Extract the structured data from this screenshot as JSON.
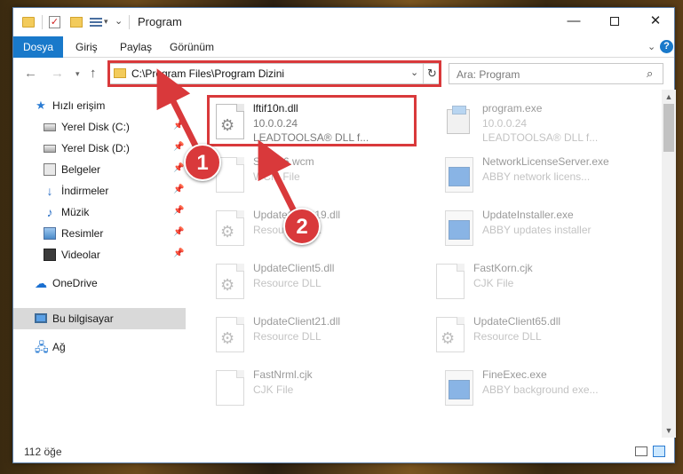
{
  "window": {
    "title": "Program",
    "minimize_glyph": "—",
    "close_glyph": "✕"
  },
  "ribbon": {
    "tabs": [
      {
        "label": "Dosya",
        "active": true
      },
      {
        "label": "Giriş"
      },
      {
        "label": "Paylaş"
      },
      {
        "label": "Görünüm"
      }
    ],
    "help_glyph": "?"
  },
  "nav": {
    "back_glyph": "←",
    "forward_glyph": "→",
    "up_glyph": "↑",
    "address": "C:\\Program Files\\Program Dizini",
    "search_placeholder": "Ara: Program"
  },
  "sidebar": {
    "items": [
      {
        "label": "Hızlı erişim",
        "icon": "star-icon",
        "pinned": false
      },
      {
        "label": "Yerel Disk (C:)",
        "icon": "drive-icon",
        "pinned": true
      },
      {
        "label": "Yerel Disk (D:)",
        "icon": "drive-icon",
        "pinned": true
      },
      {
        "label": "Belgeler",
        "icon": "documents-icon",
        "pinned": true
      },
      {
        "label": "İndirmeler",
        "icon": "download-icon",
        "pinned": true
      },
      {
        "label": "Müzik",
        "icon": "music-icon",
        "pinned": true
      },
      {
        "label": "Resimler",
        "icon": "pictures-icon",
        "pinned": true
      },
      {
        "label": "Videolar",
        "icon": "video-icon",
        "pinned": true
      },
      {
        "label": "OneDrive",
        "icon": "cloud-icon",
        "pinned": false
      },
      {
        "label": "Bu bilgisayar",
        "icon": "computer-icon",
        "pinned": false,
        "selected": true
      },
      {
        "label": "Ağ",
        "icon": "network-icon",
        "pinned": false
      }
    ]
  },
  "files": {
    "left": [
      {
        "name": "lftif10n.dll",
        "sub1": "10.0.0.24",
        "sub2": "LEADTOOLSA® DLL f...",
        "icon": "dll-gear-icon",
        "highlighted": true
      },
      {
        "name": "SWP16.wcm",
        "sub1": "WCM File",
        "sub2": "",
        "icon": "document-icon"
      },
      {
        "name": "UpdateClient19.dll",
        "sub1": "Resource DLL",
        "sub2": "",
        "icon": "dll-gear-icon"
      },
      {
        "name": "UpdateClient5.dll",
        "sub1": "Resource DLL",
        "sub2": "",
        "icon": "dll-gear-icon"
      },
      {
        "name": "UpdateClient21.dll",
        "sub1": "Resource DLL",
        "sub2": "",
        "icon": "dll-gear-icon"
      },
      {
        "name": "FastNrml.cjk",
        "sub1": "CJK File",
        "sub2": "",
        "icon": "document-icon"
      }
    ],
    "right": [
      {
        "name": "program.exe",
        "sub1": "10.0.0.24",
        "sub2": "LEADTOOLSA® DLL f...",
        "icon": "program-exe-icon"
      },
      {
        "name": "NetworkLicenseServer.exe",
        "sub1": "ABBY network licens...",
        "sub2": "",
        "icon": "exe-window-icon"
      },
      {
        "name": "UpdateInstaller.exe",
        "sub1": "ABBY updates installer",
        "sub2": "",
        "icon": "exe-window-icon"
      },
      {
        "name": "FastKorn.cjk",
        "sub1": "CJK File",
        "sub2": "",
        "icon": "document-icon"
      },
      {
        "name": "UpdateClient65.dll",
        "sub1": "Resource DLL",
        "sub2": "",
        "icon": "dll-gear-icon"
      },
      {
        "name": "FineExec.exe",
        "sub1": "ABBY background exe...",
        "sub2": "",
        "icon": "exe-window-icon"
      }
    ]
  },
  "status": {
    "count": "112 öğe"
  },
  "annotations": {
    "step1": "1",
    "step2": "2",
    "color": "#d9393b"
  }
}
